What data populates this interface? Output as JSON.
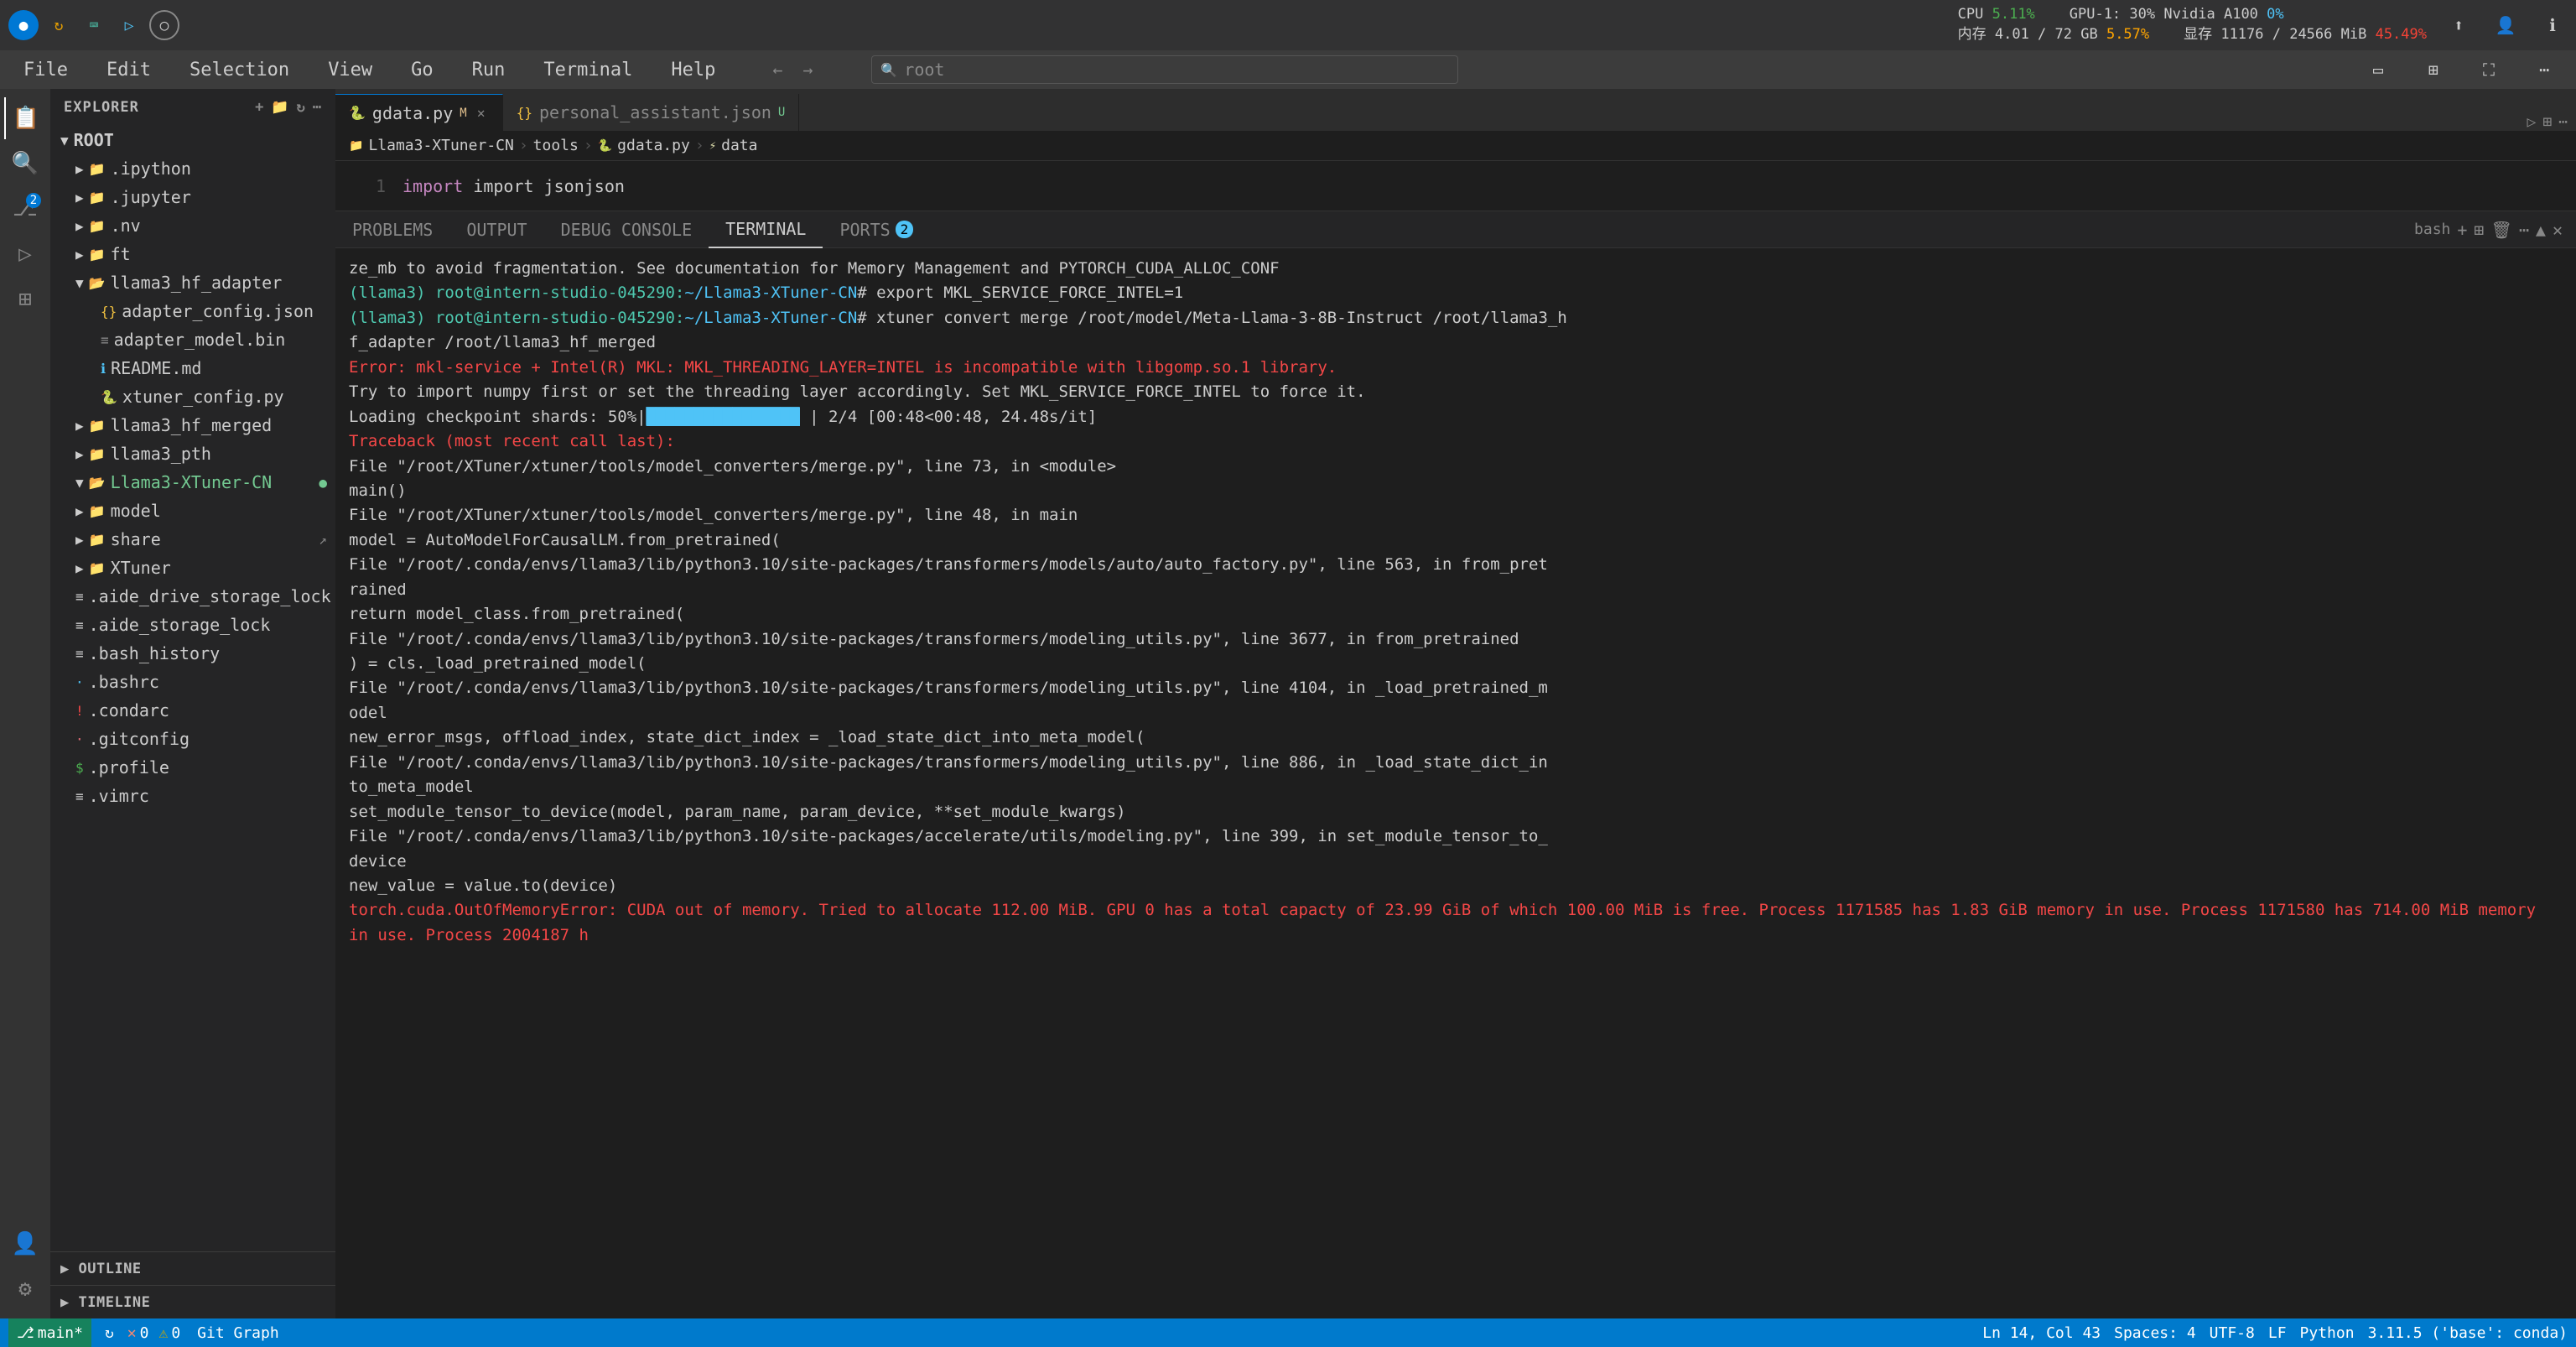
{
  "titlebar": {
    "icons": [
      "🔵",
      "🔄",
      "📘",
      "▶"
    ],
    "cpu_label": "CPU",
    "cpu_val": "5.11%",
    "gpu_label": "GPU-1: 30% Nvidia A100",
    "gpu_pct": "0%",
    "ram_label": "内存 4.01 / 72 GB",
    "ram_pct": "5.57%",
    "vram_label": "显存 11176 / 24566 MiB",
    "vram_pct": "45.49%"
  },
  "menubar": {
    "items": [
      "File",
      "Edit",
      "Selection",
      "View",
      "Go",
      "Run",
      "Terminal",
      "Help"
    ]
  },
  "search": {
    "placeholder": "root"
  },
  "sidebar": {
    "title": "EXPLORER",
    "root_label": "ROOT",
    "items": [
      {
        "indent": 1,
        "icon": "▶",
        "label": ".ipython",
        "type": "folder"
      },
      {
        "indent": 1,
        "icon": "▶",
        "label": ".jupyter",
        "type": "folder"
      },
      {
        "indent": 1,
        "icon": "▶",
        "label": ".nv",
        "type": "folder"
      },
      {
        "indent": 1,
        "icon": "▶",
        "label": "ft",
        "type": "folder"
      },
      {
        "indent": 1,
        "icon": "▼",
        "label": "llama3_hf_adapter",
        "type": "folder",
        "active": true
      },
      {
        "indent": 2,
        "icon": "{}",
        "label": "adapter_config.json",
        "type": "json"
      },
      {
        "indent": 2,
        "icon": "≡",
        "label": "adapter_model.bin",
        "type": "bin"
      },
      {
        "indent": 2,
        "icon": "ℹ",
        "label": "README.md",
        "type": "md"
      },
      {
        "indent": 2,
        "icon": "🐍",
        "label": "xtuner_config.py",
        "type": "py"
      },
      {
        "indent": 1,
        "icon": "▶",
        "label": "llama3_hf_merged",
        "type": "folder"
      },
      {
        "indent": 1,
        "icon": "▶",
        "label": "llama3_pth",
        "type": "folder"
      },
      {
        "indent": 1,
        "icon": "▼",
        "label": "Llama3-XTuner-CN",
        "type": "folder",
        "git": "green"
      },
      {
        "indent": 1,
        "icon": "▶",
        "label": "model",
        "type": "folder"
      },
      {
        "indent": 1,
        "icon": "▶",
        "label": "share",
        "type": "folder"
      },
      {
        "indent": 1,
        "icon": "▶",
        "label": "XTuner",
        "type": "folder"
      },
      {
        "indent": 1,
        "icon": "▶",
        "label": ".aide_drive_storage_lock",
        "type": "file"
      },
      {
        "indent": 1,
        "icon": "≡",
        "label": ".aide_storage_lock",
        "type": "file"
      },
      {
        "indent": 1,
        "icon": "≡",
        "label": ".bash_history",
        "type": "file"
      },
      {
        "indent": 1,
        "icon": "·",
        "label": ".bashrc",
        "type": "file"
      },
      {
        "indent": 1,
        "icon": "!",
        "label": ".condarc",
        "type": "file"
      },
      {
        "indent": 1,
        "icon": "·",
        "label": ".gitconfig",
        "type": "file"
      },
      {
        "indent": 1,
        "icon": "$",
        "label": ".profile",
        "type": "file"
      },
      {
        "indent": 1,
        "icon": "≡",
        "label": ".vimrc",
        "type": "file"
      }
    ],
    "outline_label": "OUTLINE",
    "timeline_label": "TIMELINE"
  },
  "tabs": [
    {
      "label": "gdata.py",
      "modified": "M",
      "active": true,
      "type": "py"
    },
    {
      "label": "personal_assistant.json",
      "modified": "U",
      "active": false,
      "type": "json"
    }
  ],
  "breadcrumb": {
    "parts": [
      "Llama3-XTuner-CN",
      "tools",
      "gdata.py",
      "data"
    ]
  },
  "code_line": {
    "num": "1",
    "content": "import json"
  },
  "terminal": {
    "tabs": [
      {
        "label": "PROBLEMS"
      },
      {
        "label": "OUTPUT"
      },
      {
        "label": "DEBUG CONSOLE"
      },
      {
        "label": "TERMINAL",
        "active": true
      },
      {
        "label": "PORTS",
        "badge": "2"
      }
    ],
    "shell_label": "bash",
    "content": [
      "ze_mb to avoid fragmentation.  See documentation for Memory Management and PYTORCH_CUDA_ALLOC_CONF",
      "(llama3) root@intern-studio-045290:~/Llama3-XTuner-CN# export MKL_SERVICE_FORCE_INTEL=1",
      "(llama3) root@intern-studio-045290:~/Llama3-XTuner-CN# xtuner convert merge /root/model/Meta-Llama-3-8B-Instruct /root/llama3_hf_adapter /root/llama3_hf_merged",
      "Error: mkl-service + Intel(R) MKL: MKL_THREADING_LAYER=INTEL is incompatible with libgomp.so.1 library.",
      "        Try to import numpy first or set the threading layer accordingly. Set MKL_SERVICE_FORCE_INTEL to force it.",
      "Loading checkpoint shards:  50%|████████████████                | 2/4 [00:48<00:48, 24.48s/it]",
      "Traceback (most recent call last):",
      "  File \"/root/XTuner/xtuner/tools/model_converters/merge.py\", line 73, in <module>",
      "    main()",
      "  File \"/root/XTuner/xtuner/tools/model_converters/merge.py\", line 48, in main",
      "    model = AutoModelForCausalLM.from_pretrained(",
      "  File \"/root/.conda/envs/llama3/lib/python3.10/site-packages/transformers/models/auto/auto_factory.py\", line 563, in from_pretrained",
      "    return model_class.from_pretrained(",
      "  File \"/root/.conda/envs/llama3/lib/python3.10/site-packages/transformers/modeling_utils.py\", line 3677, in from_pretrained",
      "    ) = cls._load_pretrained_model(",
      "  File \"/root/.conda/envs/llama3/lib/python3.10/site-packages/transformers/modeling_utils.py\", line 4104, in _load_pretrained_model",
      "    new_error_msgs, offload_index, state_dict_index = _load_state_dict_into_meta_model(",
      "  File \"/root/.conda/envs/llama3/lib/python3.10/site-packages/transformers/modeling_utils.py\", line 886, in _load_state_dict_into_meta_model",
      "    set_module_tensor_to_device(model, param_name, param_device, **set_module_kwargs)",
      "  File \"/root/.conda/envs/llama3/lib/python3.10/site-packages/accelerate/utils/modeling.py\", line 399, in set_module_tensor_to_device",
      "    new_value = value.to(device)",
      "torch.cuda.OutOfMemoryError: CUDA out of memory. Tried to allocate 112.00 MiB. GPU 0 has a total capacty of 23.99 GiB of which 100.00 MiB is free. Process 1171585 has 1.83 GiB memory in use. Process 1171580 has 714.00 MiB memory in use. Process 2004187 h"
    ]
  },
  "statusbar": {
    "branch": "main*",
    "sync_icon": "↻",
    "errors": "0",
    "warnings": "0",
    "git_graph": "Git Graph",
    "line_col": "Ln 14, Col 43",
    "spaces": "Spaces: 4",
    "encoding": "UTF-8",
    "eol": "LF",
    "language": "Python",
    "version": "3.11.5 ('base': conda)"
  }
}
